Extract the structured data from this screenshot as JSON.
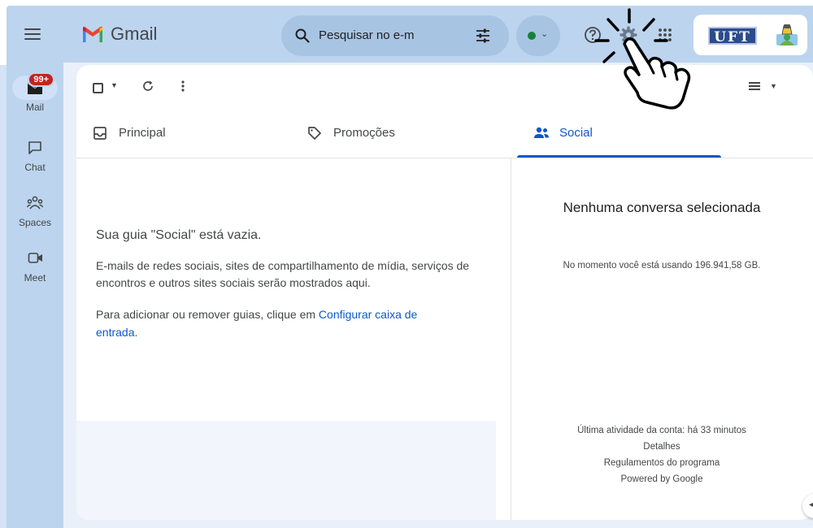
{
  "app": {
    "name": "Gmail"
  },
  "rail": {
    "items": [
      {
        "label": "Mail",
        "badge": "99+"
      },
      {
        "label": "Chat"
      },
      {
        "label": "Spaces"
      },
      {
        "label": "Meet"
      }
    ]
  },
  "search": {
    "placeholder": "Pesquisar no e-m"
  },
  "account": {
    "logo_text": "UFT"
  },
  "tabs": [
    {
      "label": "Principal"
    },
    {
      "label": "Promoções"
    },
    {
      "label": "Social"
    }
  ],
  "empty_state": {
    "title": "Sua guia \"Social\" está vazia.",
    "description": "E-mails de redes sociais, sites de compartilhamento de mídia, serviços de encontros e outros sites sociais serão mostrados aqui.",
    "hint_prefix": "Para adicionar ou remover guias, clique em ",
    "hint_link": "Configurar caixa de entrada",
    "hint_suffix": "."
  },
  "preview": {
    "title": "Nenhuma conversa selecionada",
    "storage": "No momento você está usando 196.941,58 GB."
  },
  "footer": {
    "last_activity": "Última atividade da conta: há 33 minutos",
    "details": "Detalhes",
    "program_policies": "Regulamentos do programa",
    "powered_by": "Powered by Google"
  },
  "colors": {
    "accent": "#0b57d0",
    "badge": "#c5221f",
    "status": "#188038",
    "shell_background": "#bcd4ee"
  }
}
